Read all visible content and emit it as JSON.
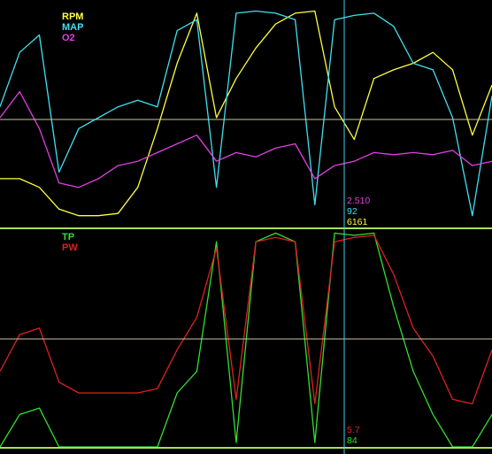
{
  "panels": [
    {
      "id": "top",
      "legend": [
        {
          "label": "RPM",
          "color": "#ffff40"
        },
        {
          "label": "MAP",
          "color": "#40e0f0"
        },
        {
          "label": "O2",
          "color": "#e040e0"
        }
      ],
      "cursor_readouts": [
        {
          "text": "2.510",
          "color": "#e040e0"
        },
        {
          "text": "92",
          "color": "#40e0f0"
        },
        {
          "text": "6161",
          "color": "#ffff40"
        }
      ]
    },
    {
      "id": "bottom",
      "legend": [
        {
          "label": "TP",
          "color": "#30e030"
        },
        {
          "label": "PW",
          "color": "#e02020"
        }
      ],
      "cursor_readouts": [
        {
          "text": "5.7",
          "color": "#e02020"
        },
        {
          "text": "84",
          "color": "#30e030"
        }
      ]
    }
  ],
  "colors": {
    "background": "#000000",
    "divider": "#a8e060",
    "reference_line": "#c8c8a0",
    "cursor": "#40d0e8"
  },
  "chart_data": [
    {
      "type": "line",
      "title": "",
      "grid": false,
      "legend_position": "top-left",
      "x": [
        0,
        4,
        8,
        12,
        16,
        20,
        24,
        28,
        32,
        36,
        40,
        44,
        48,
        52,
        56,
        60,
        64,
        68,
        72,
        76,
        80,
        84,
        88,
        92,
        96,
        100
      ],
      "series": [
        {
          "name": "RPM",
          "color": "#ffff40",
          "values": [
            0.22,
            0.22,
            0.18,
            0.08,
            0.05,
            0.05,
            0.06,
            0.18,
            0.45,
            0.75,
            0.98,
            0.5,
            0.68,
            0.82,
            0.93,
            0.98,
            0.99,
            0.55,
            0.4,
            0.68,
            0.72,
            0.75,
            0.8,
            0.72,
            0.42,
            0.65
          ]
        },
        {
          "name": "MAP",
          "color": "#40e0f0",
          "values": [
            0.55,
            0.8,
            0.88,
            0.25,
            0.45,
            0.5,
            0.55,
            0.58,
            0.55,
            0.9,
            0.95,
            0.18,
            0.98,
            0.99,
            0.98,
            0.95,
            0.1,
            0.95,
            0.97,
            0.98,
            0.92,
            0.75,
            0.72,
            0.5,
            0.05,
            0.6
          ]
        },
        {
          "name": "O2",
          "color": "#e040e0",
          "values": [
            0.5,
            0.62,
            0.45,
            0.2,
            0.18,
            0.22,
            0.28,
            0.3,
            0.34,
            0.38,
            0.42,
            0.3,
            0.34,
            0.32,
            0.36,
            0.38,
            0.22,
            0.28,
            0.3,
            0.34,
            0.33,
            0.34,
            0.33,
            0.35,
            0.28,
            0.3
          ]
        }
      ],
      "cursor_values": {
        "O2": 2.51,
        "MAP": 92,
        "RPM": 6161
      }
    },
    {
      "type": "line",
      "title": "",
      "grid": false,
      "legend_position": "top-left",
      "x": [
        0,
        4,
        8,
        12,
        16,
        20,
        24,
        28,
        32,
        36,
        40,
        44,
        48,
        52,
        56,
        60,
        64,
        68,
        72,
        76,
        80,
        84,
        88,
        92,
        96,
        100
      ],
      "series": [
        {
          "name": "TP",
          "color": "#30e030",
          "values": [
            0.0,
            0.15,
            0.18,
            0.0,
            0.0,
            0.0,
            0.0,
            0.0,
            0.0,
            0.25,
            0.35,
            0.95,
            0.02,
            0.95,
            0.99,
            0.95,
            0.02,
            0.99,
            0.98,
            0.99,
            0.65,
            0.35,
            0.15,
            0.0,
            0.0,
            0.15
          ]
        },
        {
          "name": "PW",
          "color": "#e02020",
          "values": [
            0.35,
            0.52,
            0.55,
            0.3,
            0.25,
            0.25,
            0.25,
            0.25,
            0.27,
            0.45,
            0.6,
            0.92,
            0.22,
            0.95,
            0.97,
            0.95,
            0.2,
            0.95,
            0.97,
            0.98,
            0.8,
            0.55,
            0.42,
            0.22,
            0.2,
            0.45
          ]
        }
      ],
      "cursor_values": {
        "PW": 5.7,
        "TP": 84
      }
    }
  ]
}
